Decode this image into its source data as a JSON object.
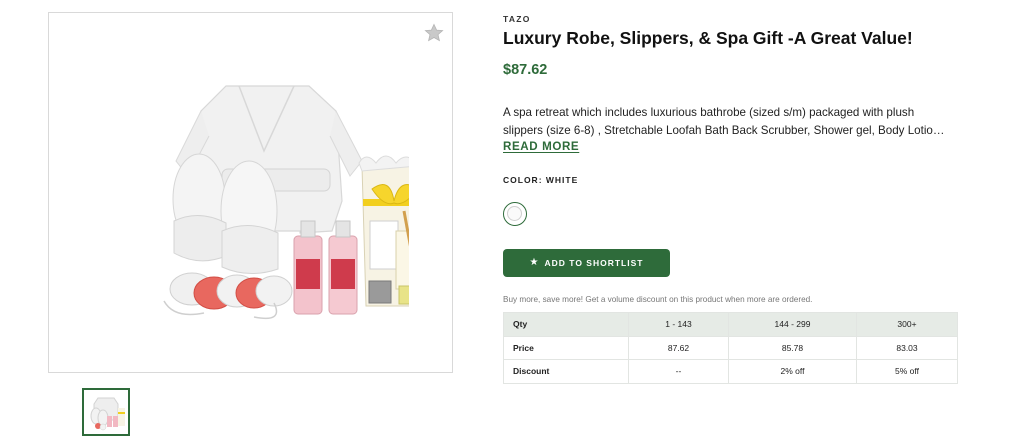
{
  "gallery": {
    "favorite_icon": "star-icon",
    "main_image_alt": "Bathrobe, slippers, loofah and spa bath products gift set"
  },
  "product": {
    "brand": "TAZO",
    "title": "Luxury Robe, Slippers, & Spa Gift -A Great Value!",
    "price": "$87.62",
    "description_lines": [
      "A spa retreat which includes luxurious bathrobe (sized s/m) packaged with plush",
      "slippers (size 6-8) , Stretchable Loofah Bath Back Scrubber, Shower gel, Body Lotio…"
    ],
    "read_more": "READ MORE",
    "color_label": "COLOR: WHITE",
    "selected_color": "#ffffff",
    "shortlist_button": "ADD TO SHORTLIST",
    "shortlist_icon": "star-icon",
    "volume_note": "Buy more, save more! Get a volume discount on this product when more are ordered."
  },
  "pricing_table": {
    "headers": [
      "Qty",
      "1 - 143",
      "144 - 299",
      "300+"
    ],
    "rows": [
      [
        "Price",
        "87.62",
        "85.78",
        "83.03"
      ],
      [
        "Discount",
        "--",
        "2% off",
        "5% off"
      ]
    ]
  },
  "colors": {
    "accent": "#2e6b3a",
    "table_header_bg": "#e6ebe6"
  }
}
